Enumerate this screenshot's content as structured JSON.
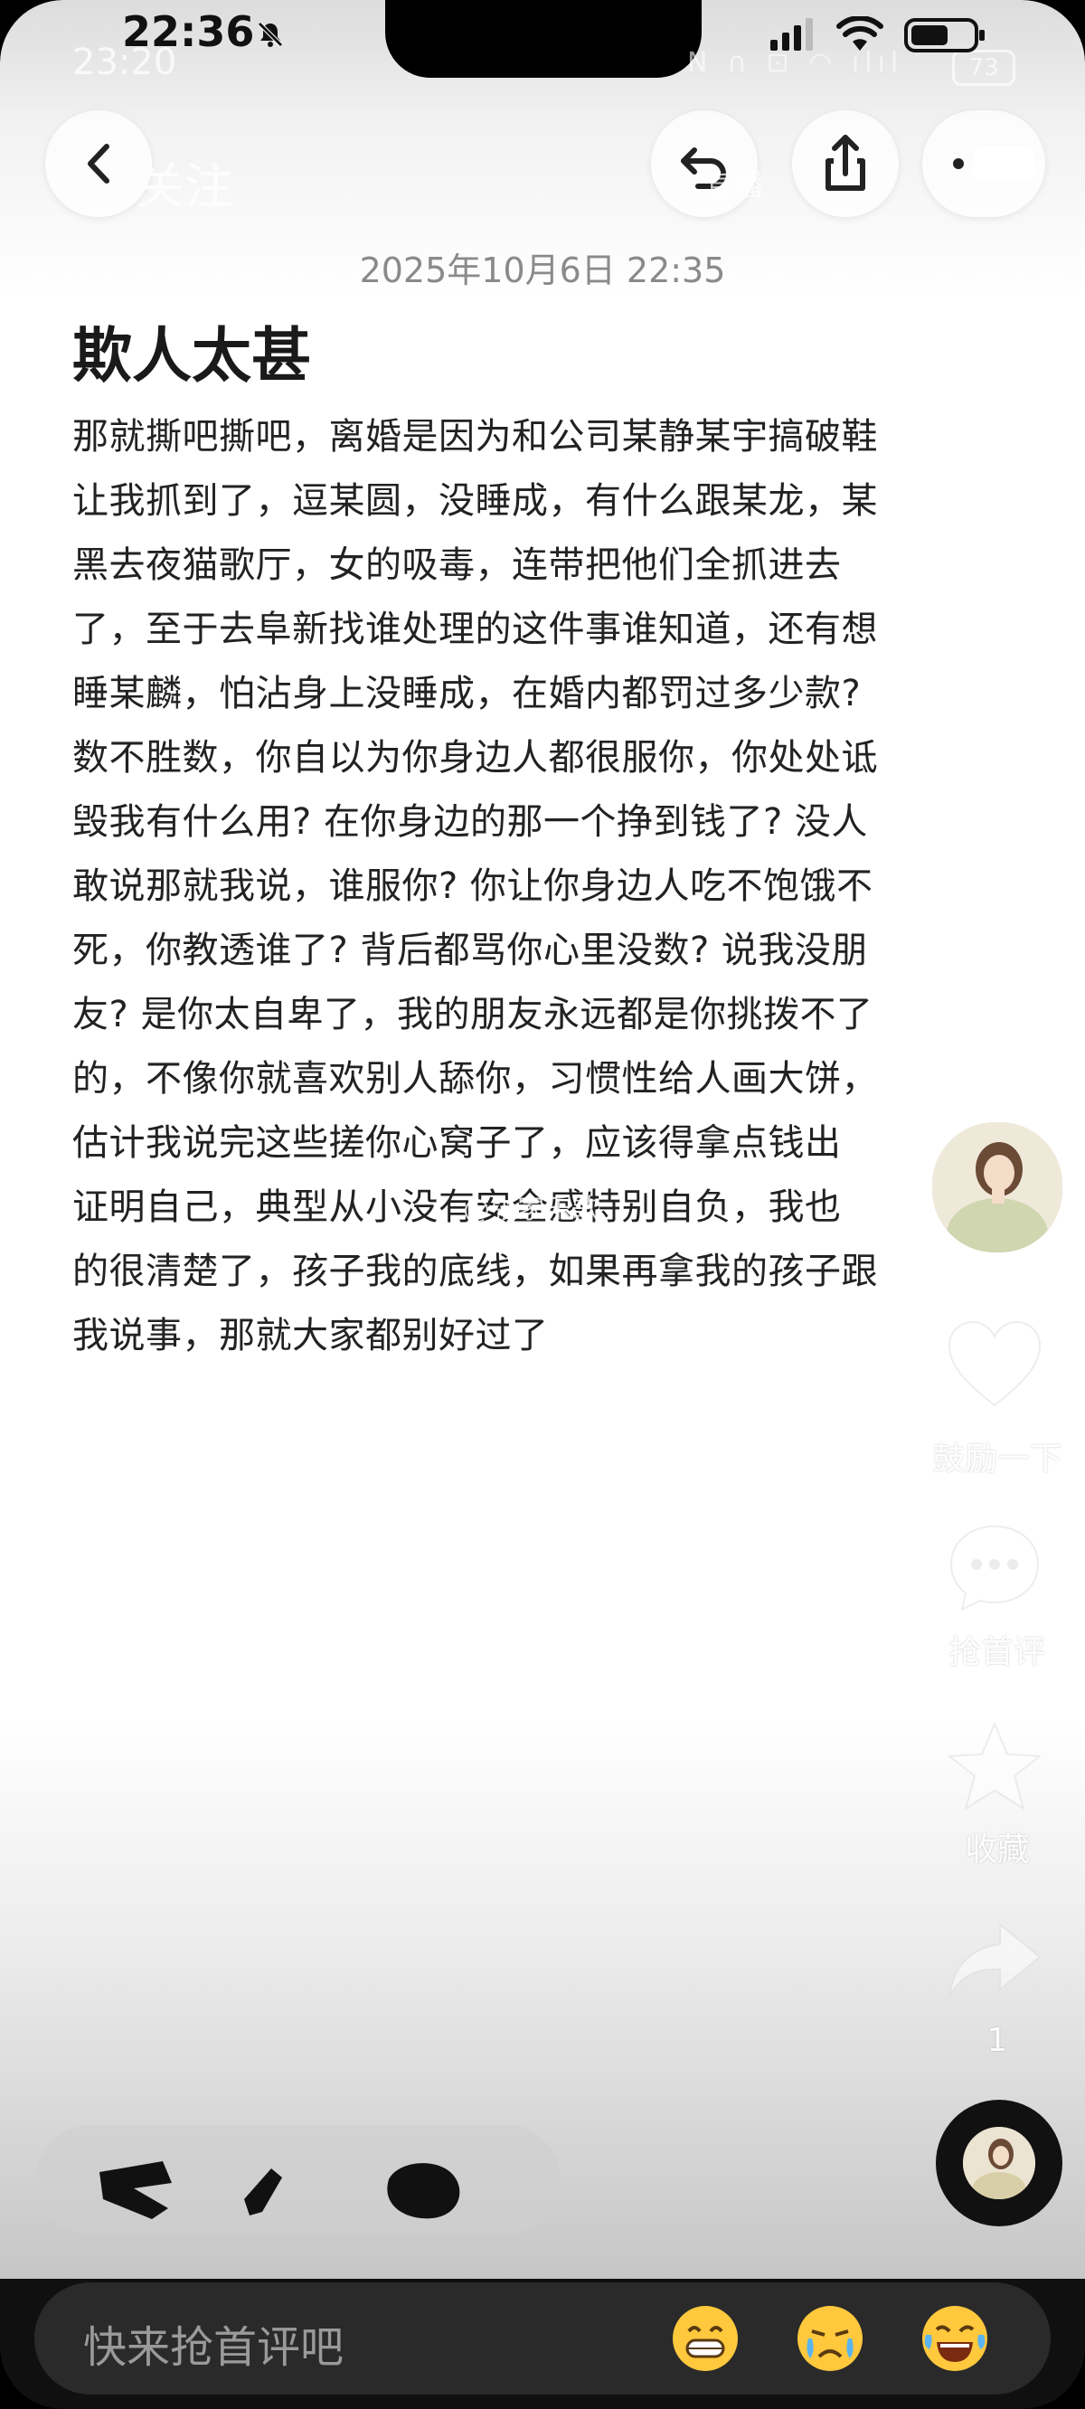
{
  "status_bar": {
    "time": "22:36",
    "ghost_time": "23:20",
    "battery_level": "73"
  },
  "nav": {
    "follow_label": "关注",
    "live_label": "直播"
  },
  "article": {
    "date": "2025年10月6日 22:35",
    "title": "欺人太甚",
    "lines": [
      "那就撕吧撕吧，离婚是因为和公司某静某宇搞破鞋",
      "让我抓到了，逗某圆，没睡成，有什么跟某龙，某",
      "黑去夜猫歌厅，女的吸毒，连带把他们全抓进去",
      "了，至于去阜新找谁处理的这件事谁知道，还有想",
      "睡某麟，怕沾身上没睡成，在婚内都罚过多少款?",
      "数不胜数，你自以为你身边人都很服你，你处处诋",
      "毁我有什么用? 在你身边的那一个挣到钱了? 没人",
      "敢说那就我说，谁服你? 你让你身边人吃不饱饿不",
      "死，你教透谁了? 背后都骂你心里没数? 说我没朋",
      "友? 是你太自卑了，我的朋友永远都是你挑拨不了",
      "的，不像你就喜欢别人舔你，习惯性给人画大饼，",
      "估计我说完这些搓你心窝子了，应该得拿点钱出",
      "证明自己，典型从小没有安全感特别自负，我也",
      "的很清楚了，孩子我的底线，如果再拿我的孩子跟",
      "我说事，那就大家都别好过了"
    ]
  },
  "watermark": "@张家乐歌",
  "rail": {
    "like_label": "鼓励一下",
    "comment_label": "抢首评",
    "favorite_label": "收藏",
    "share_count": "1"
  },
  "comment_bar": {
    "placeholder": "快来抢首评吧"
  },
  "icons": [
    "back-icon",
    "reply-icon",
    "share-icon",
    "more-icon",
    "heart-icon",
    "comment-icon",
    "star-icon",
    "share-arrow-icon",
    "grin-emoji-icon",
    "cry-emoji-icon",
    "laugh-emoji-icon"
  ]
}
